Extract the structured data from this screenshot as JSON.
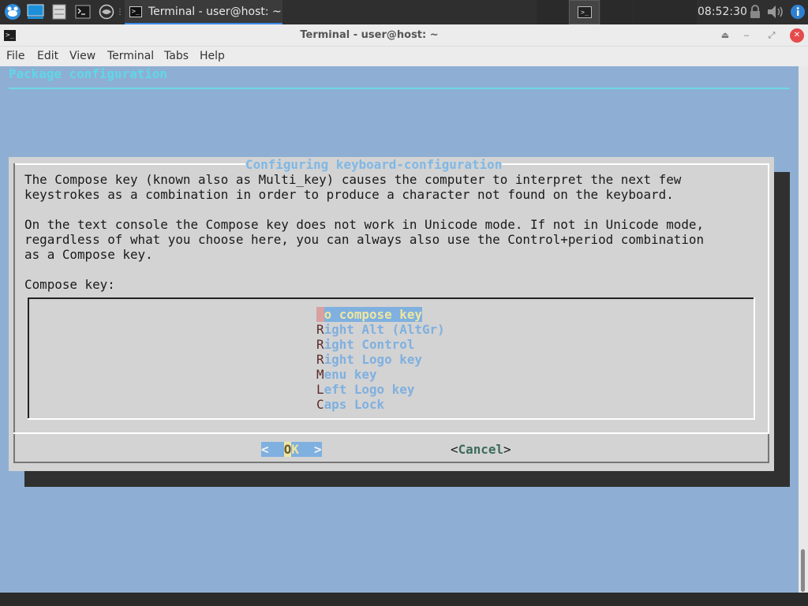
{
  "panel": {
    "task_title": "Terminal - user@host: ~",
    "clock": "08:52:30",
    "launcher_icons": [
      "xfce-menu-icon",
      "desktop-icon",
      "file-manager-icon",
      "terminal-icon",
      "web-browser-icon"
    ]
  },
  "window": {
    "title": "Terminal - user@host: ~",
    "menu": [
      "File",
      "Edit",
      "View",
      "Terminal",
      "Tabs",
      "Help"
    ]
  },
  "terminal": {
    "header": "Package configuration",
    "dialog_title": "Configuring keyboard-configuration",
    "text_lines": [
      "The Compose key (known also as Multi_key) causes the computer to interpret the next few",
      "keystrokes as a combination in order to produce a character not found on the keyboard.",
      "",
      "On the text console the Compose key does not work in Unicode mode. If not in Unicode mode,",
      "regardless of what you choose here, you can always also use the Control+period combination",
      "as a Compose key.",
      "",
      "Compose key:"
    ],
    "options": [
      {
        "hotkey": "N",
        "rest": "o compose key"
      },
      {
        "hotkey": "R",
        "rest": "ight Alt (AltGr)"
      },
      {
        "hotkey": "R",
        "rest": "ight Control"
      },
      {
        "hotkey": "R",
        "rest": "ight Logo key"
      },
      {
        "hotkey": "M",
        "rest": "enu key"
      },
      {
        "hotkey": "L",
        "rest": "eft Logo key"
      },
      {
        "hotkey": "C",
        "rest": "aps Lock"
      }
    ],
    "selected_option": 0,
    "ok_button": {
      "left": "<  ",
      "key": "O",
      "rest": "K",
      "right": "  >"
    },
    "cancel_button": {
      "left": "<",
      "key": "C",
      "rest": "ancel",
      "right": ">"
    }
  }
}
